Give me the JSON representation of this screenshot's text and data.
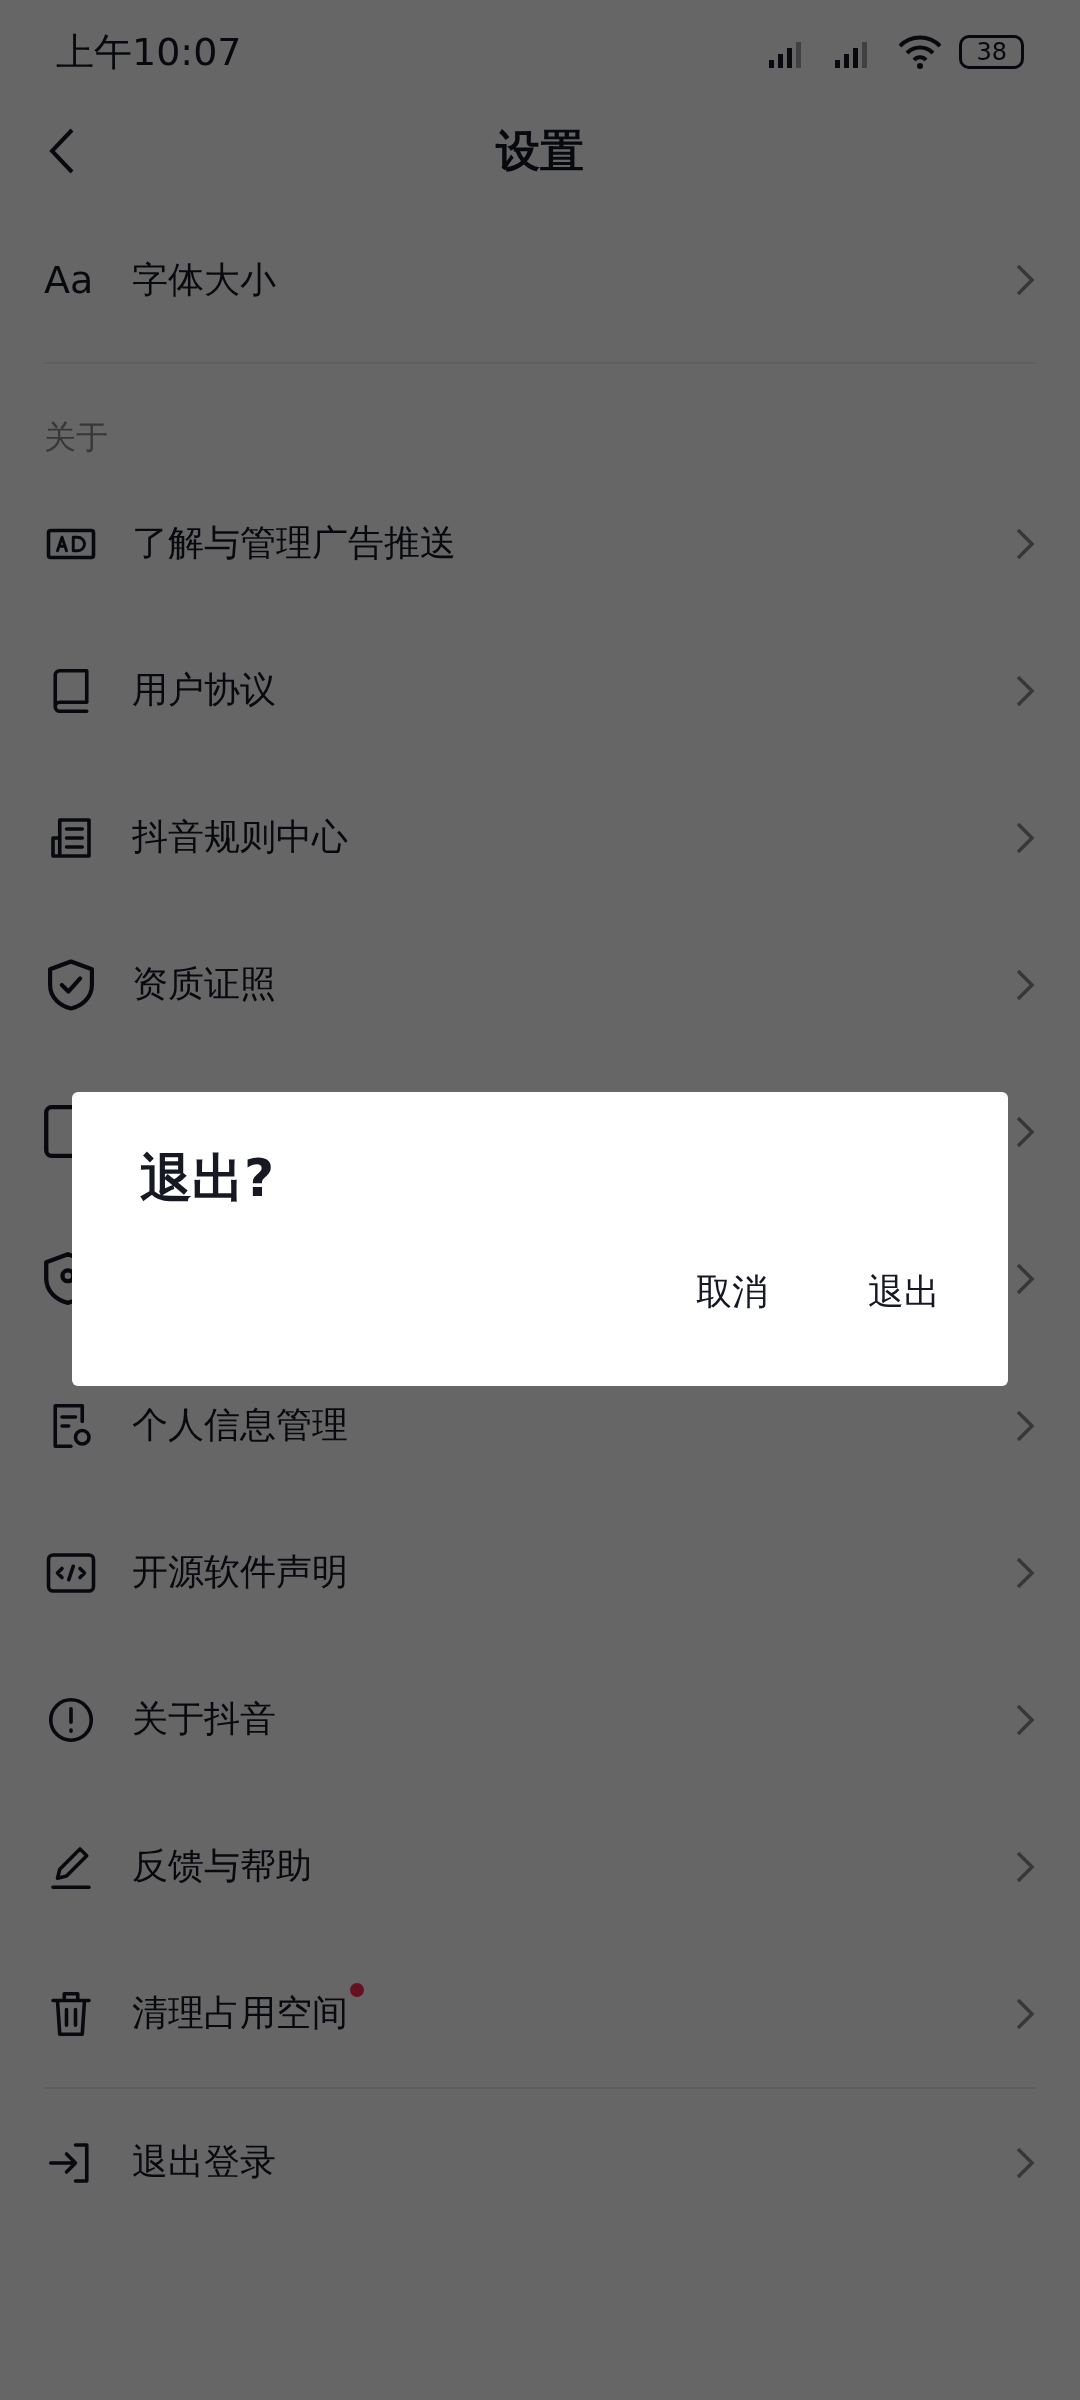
{
  "status_bar": {
    "time": "上午10:07",
    "battery": "38"
  },
  "header": {
    "title": "设置"
  },
  "top_rows": [
    {
      "label": "字体大小",
      "icon_text": "Aa"
    }
  ],
  "section": {
    "title": "关于"
  },
  "rows": [
    {
      "label": "了解与管理广告推送",
      "dot": false
    },
    {
      "label": "用户协议",
      "dot": false
    },
    {
      "label": "抖音规则中心",
      "dot": false
    },
    {
      "label": "资质证照",
      "dot": false
    },
    {
      "dot": false
    },
    {
      "dot": false
    },
    {
      "label": "个人信息管理",
      "dot": false
    },
    {
      "label": "开源软件声明",
      "dot": false
    },
    {
      "label": "关于抖音",
      "dot": false
    },
    {
      "label": "反馈与帮助",
      "dot": false
    },
    {
      "label": "清理占用空间",
      "dot": true
    }
  ],
  "bottom_rows": [
    {
      "label": "退出登录"
    }
  ],
  "dialog": {
    "title": "退出?",
    "buttons": [
      {
        "label": "取消"
      },
      {
        "label": "退出"
      }
    ]
  }
}
